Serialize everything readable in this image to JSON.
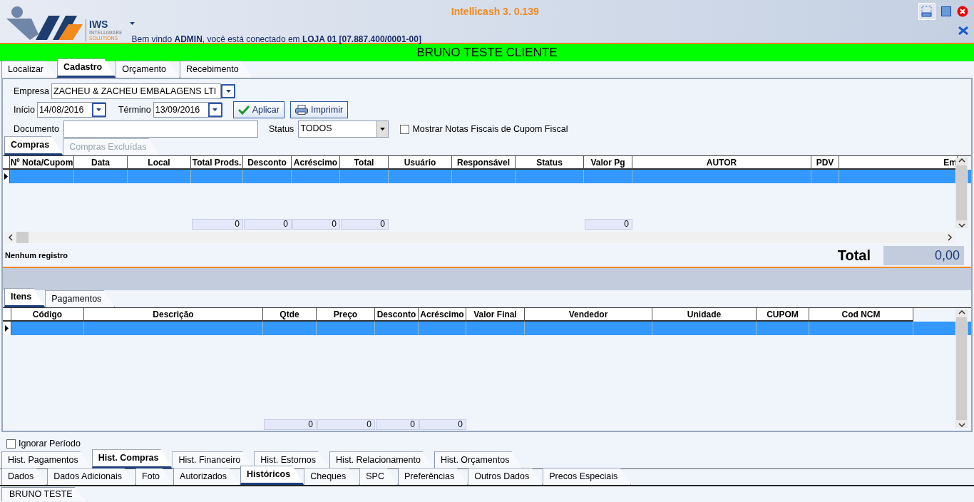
{
  "header": {
    "title": "Intellicash 3. 0.139",
    "logo": {
      "name": "IWS",
      "line1": "INTELLIWARE",
      "line2": "SOLUTIONS"
    },
    "welcome": "Bem vindo **ADMIN**, você está conectado em **LOJA 01 [07.887.400/0001-00]**"
  },
  "client_banner": "BRUNO TESTE CLIENTE",
  "top_tabs": [
    {
      "label": "Localizar",
      "selected": false
    },
    {
      "label": "Cadastro",
      "selected": true
    },
    {
      "label": "Orçamento",
      "selected": false
    },
    {
      "label": "Recebimento",
      "selected": false
    }
  ],
  "filters": {
    "empresa": {
      "label": "Empresa",
      "value": "ZACHEU & ZACHEU EMBALAGENS LTI"
    },
    "inicio": {
      "label": "Início",
      "value": "14/08/2016"
    },
    "termino": {
      "label": "Término",
      "value": "13/09/2016"
    },
    "buttons": [
      {
        "label": "Aplicar",
        "kind": "apply"
      },
      {
        "label": "Imprimir",
        "kind": "print"
      }
    ],
    "documento": {
      "label": "Documento"
    },
    "status": {
      "label": "Status",
      "value": "TODOS"
    },
    "cupom_checkbox": {
      "label": "Mostrar Notas Fiscais de Cupom Fiscal",
      "checked": false
    }
  },
  "purchase_tabs": [
    {
      "label": "Compras",
      "selected": true,
      "disabled": false
    },
    {
      "label": "Compras Excluídas",
      "selected": false,
      "disabled": true
    }
  ],
  "purchases_table": {
    "columns": [
      {
        "label": "Nº Nota/Cupom"
      },
      {
        "label": "Data"
      },
      {
        "label": "Local"
      },
      {
        "label": "Total Prods.",
        "total": "0"
      },
      {
        "label": "Desconto",
        "total": "0"
      },
      {
        "label": "Acréscimo",
        "total": "0"
      },
      {
        "label": "Total",
        "total": "0"
      },
      {
        "label": "Usuário"
      },
      {
        "label": "Responsável"
      },
      {
        "label": "Status"
      },
      {
        "label": "Valor Pg",
        "total": "0"
      },
      {
        "label": "AUTOR"
      },
      {
        "label": "PDV"
      },
      {
        "label": "Em"
      }
    ],
    "rows": [
      {
        "selected": true
      }
    ]
  },
  "summary": {
    "message": "Nenhum registro",
    "total_label": "Total",
    "total_value": "0,00"
  },
  "item_tabs": [
    {
      "label": "Itens",
      "selected": true
    },
    {
      "label": "Pagamentos",
      "selected": false
    }
  ],
  "items_table": {
    "columns": [
      {
        "label": "Código"
      },
      {
        "label": "Descrição"
      },
      {
        "label": "Qtde",
        "total": "0"
      },
      {
        "label": "Preço",
        "total": "0"
      },
      {
        "label": "Desconto",
        "total": "0"
      },
      {
        "label": "Acréscimo",
        "total": "0"
      },
      {
        "label": "Valor Final"
      },
      {
        "label": "Vendedor"
      },
      {
        "label": "Unidade"
      },
      {
        "label": "CUPOM"
      },
      {
        "label": "Cod NCM"
      }
    ],
    "rows": [
      {
        "selected": true
      }
    ]
  },
  "ignore_period": {
    "label": "Ignorar Período",
    "checked": false
  },
  "history_tabs": [
    {
      "label": "Hist. Pagamentos",
      "selected": false
    },
    {
      "label": "Hist. Compras",
      "selected": true
    },
    {
      "label": "Hist. Financeiro",
      "selected": false
    },
    {
      "label": "Hist. Estornos",
      "selected": false
    },
    {
      "label": "Hist. Relacionamento",
      "selected": false
    },
    {
      "label": "Hist. Orçamentos",
      "selected": false
    }
  ],
  "main_tabs": [
    {
      "label": "Dados",
      "selected": false
    },
    {
      "label": "Dados Adicionais",
      "selected": false
    },
    {
      "label": "Foto",
      "selected": false
    },
    {
      "label": "Autorizados",
      "selected": false
    },
    {
      "label": "Históricos",
      "selected": true
    },
    {
      "label": "Cheques",
      "selected": false
    },
    {
      "label": "SPC",
      "selected": false
    },
    {
      "label": "Preferências",
      "selected": false
    },
    {
      "label": "Outros Dados",
      "selected": false
    },
    {
      "label": "Precos Especiais",
      "selected": false
    }
  ],
  "status_tab": "BRUNO TESTE"
}
